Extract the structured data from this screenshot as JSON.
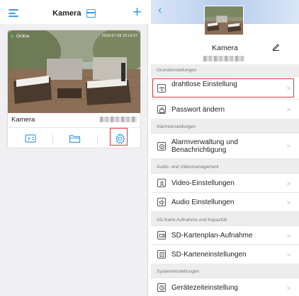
{
  "left_panel": {
    "header": {
      "title": "Kamera"
    },
    "camera_card": {
      "status": "Online",
      "timestamp": "2019-07-09  15:14:27",
      "name": "Kamera",
      "actions": [
        {
          "icon": "playback-icon",
          "label": ""
        },
        {
          "icon": "folder-icon",
          "label": ""
        },
        {
          "icon": "gear-icon",
          "label": ""
        }
      ]
    }
  },
  "right_panel": {
    "header": {
      "device_name": "Kamera"
    },
    "sections": [
      {
        "label": "Grundeinstellungen",
        "items": [
          {
            "label": "drahtlose Einstellung",
            "icon": "wifi-icon"
          },
          {
            "label": "Passwort ändern",
            "icon": "lock-icon"
          }
        ]
      },
      {
        "label": "Alarmeinstellungen",
        "items": [
          {
            "label": "Alarmverwaltung und Benachrichtigung",
            "icon": "alarm-icon"
          }
        ]
      },
      {
        "label": "Audio- und Videomanagement",
        "items": [
          {
            "label": "Video-Einstellungen",
            "icon": "video-icon"
          },
          {
            "label": "Audio Einstellungen",
            "icon": "speaker-icon"
          }
        ]
      },
      {
        "label": "SD-Karte Aufnahme und Kapazität",
        "items": [
          {
            "label": "SD-Kartenplan-Aufnahme",
            "icon": "record-icon"
          },
          {
            "label": "SD-Karteneinstellungen",
            "icon": "sdcard-icon"
          }
        ]
      },
      {
        "label": "Systemeinstellungen",
        "items": [
          {
            "label": "Gerätezeiteinstellung",
            "icon": "clock-icon"
          }
        ]
      }
    ]
  },
  "colors": {
    "accent": "#3a9de8",
    "highlight_box": "#d9363e",
    "online": "#34d058"
  }
}
